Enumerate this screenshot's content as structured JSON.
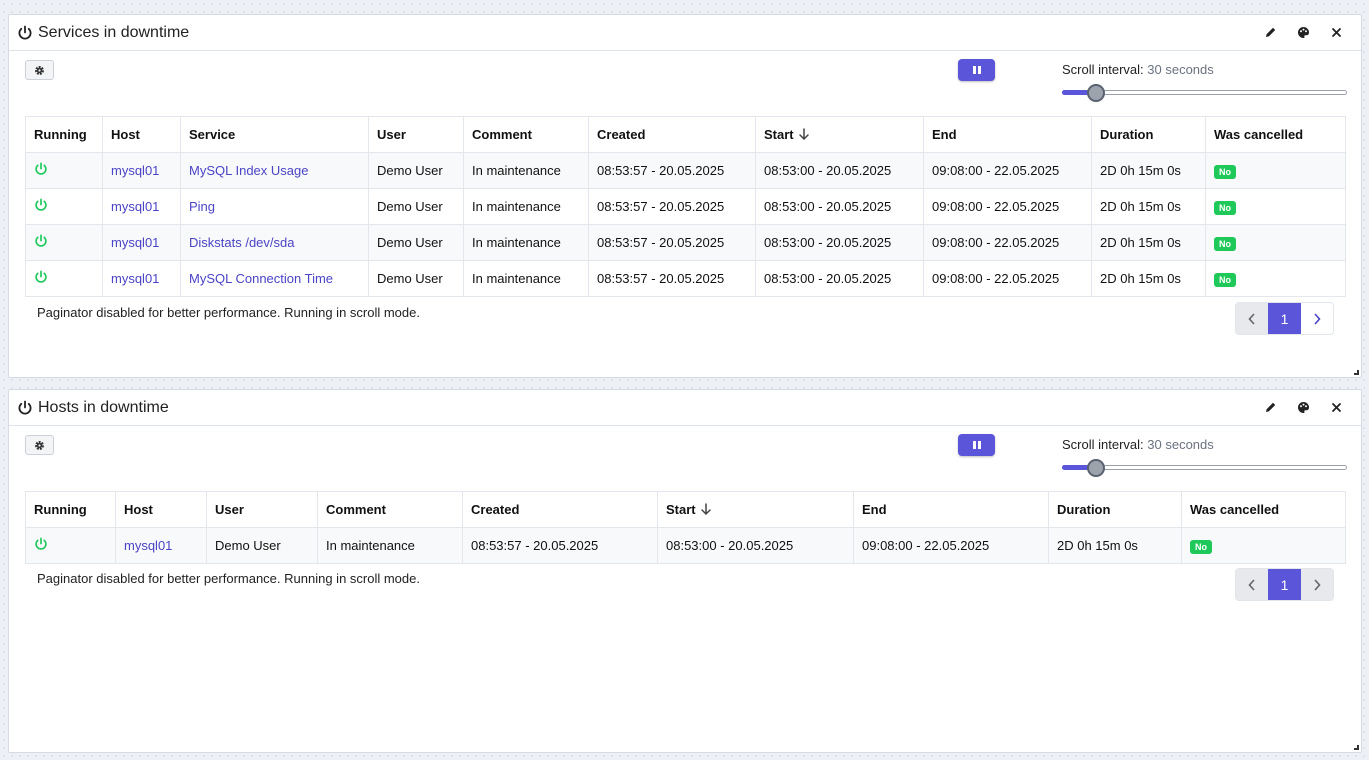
{
  "services": {
    "title": "Services in downtime",
    "scroll_label": "Scroll interval:",
    "scroll_value": "30 seconds",
    "slider_level_pct": 12,
    "columns": [
      "Running",
      "Host",
      "Service",
      "User",
      "Comment",
      "Created",
      "Start",
      "End",
      "Duration",
      "Was cancelled"
    ],
    "rows": [
      {
        "host": "mysql01",
        "service": "MySQL Index Usage",
        "user": "Demo User",
        "comment": "In maintenance",
        "created": "08:53:57 - 20.05.2025",
        "start": "08:53:00 - 20.05.2025",
        "end": "09:08:00 - 22.05.2025",
        "duration": "2D 0h 15m 0s",
        "cancelled": "No"
      },
      {
        "host": "mysql01",
        "service": "Ping",
        "user": "Demo User",
        "comment": "In maintenance",
        "created": "08:53:57 - 20.05.2025",
        "start": "08:53:00 - 20.05.2025",
        "end": "09:08:00 - 22.05.2025",
        "duration": "2D 0h 15m 0s",
        "cancelled": "No"
      },
      {
        "host": "mysql01",
        "service": "Diskstats /dev/sda",
        "user": "Demo User",
        "comment": "In maintenance",
        "created": "08:53:57 - 20.05.2025",
        "start": "08:53:00 - 20.05.2025",
        "end": "09:08:00 - 22.05.2025",
        "duration": "2D 0h 15m 0s",
        "cancelled": "No"
      },
      {
        "host": "mysql01",
        "service": "MySQL Connection Time",
        "user": "Demo User",
        "comment": "In maintenance",
        "created": "08:53:57 - 20.05.2025",
        "start": "08:53:00 - 20.05.2025",
        "end": "09:08:00 - 22.05.2025",
        "duration": "2D 0h 15m 0s",
        "cancelled": "No"
      }
    ],
    "paginator_note": "Paginator disabled for better performance. Running in scroll mode.",
    "page": "1"
  },
  "hosts": {
    "title": "Hosts in downtime",
    "scroll_label": "Scroll interval:",
    "scroll_value": "30 seconds",
    "slider_level_pct": 12,
    "columns": [
      "Running",
      "Host",
      "User",
      "Comment",
      "Created",
      "Start",
      "End",
      "Duration",
      "Was cancelled"
    ],
    "rows": [
      {
        "host": "mysql01",
        "user": "Demo User",
        "comment": "In maintenance",
        "created": "08:53:57 - 20.05.2025",
        "start": "08:53:00 - 20.05.2025",
        "end": "09:08:00 - 22.05.2025",
        "duration": "2D 0h 15m 0s",
        "cancelled": "No"
      }
    ],
    "paginator_note": "Paginator disabled for better performance. Running in scroll mode.",
    "page": "1"
  },
  "colors": {
    "accent": "#5a55d9",
    "running": "#1ec95a",
    "link": "#4a44c6"
  },
  "icons": {
    "title": "power-icon",
    "running": "power-icon",
    "edit": "pencil-icon",
    "theme": "palette-icon",
    "close": "close-icon",
    "settings": "gear-icon",
    "pause": "pause-icon",
    "sort": "arrow-down-icon"
  }
}
